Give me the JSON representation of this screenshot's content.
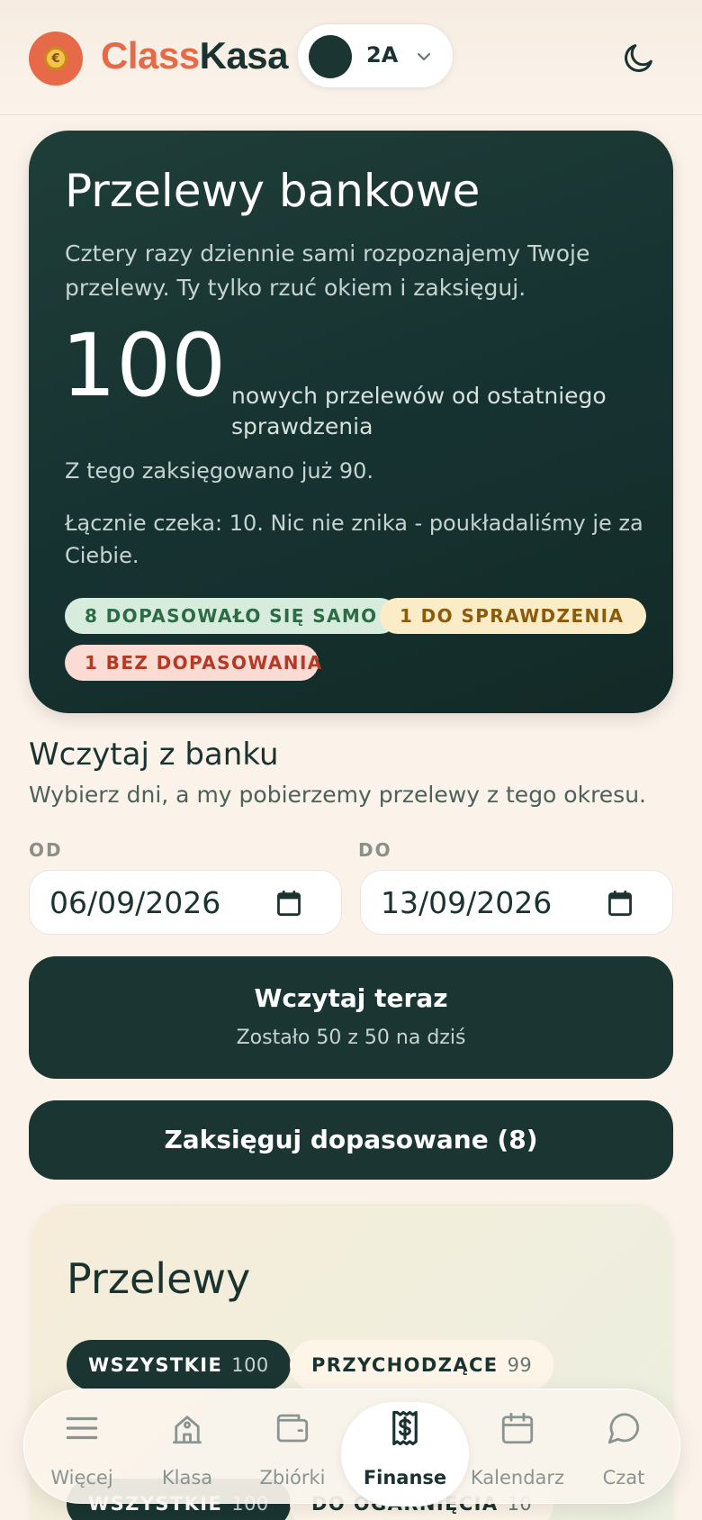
{
  "header": {
    "logo_part1": "Class",
    "logo_part2": "Kasa",
    "class_selector": "2A"
  },
  "hero": {
    "title": "Przelewy bankowe",
    "description": "Cztery razy dziennie sami rozpoznajemy Twoje przelewy. Ty tylko rzuć okiem i zaksięguj.",
    "count": "100",
    "count_label": "nowych przelewów od ostatniego sprawdzenia",
    "booked_text": "Z tego zaksięgowano już 90.",
    "waiting_text": "Łącznie czeka: 10. Nic nie znika - poukładaliśmy je za Ciebie.",
    "chips": {
      "matched": "8 DOPASOWAŁO SIĘ SAMO",
      "review": "1 DO SPRAWDZENIA",
      "unmatched": "1 BEZ DOPASOWANIA"
    }
  },
  "import": {
    "title": "Wczytaj z banku",
    "subtitle": "Wybierz dni, a my pobierzemy przelewy z tego okresu.",
    "from_label": "OD",
    "to_label": "DO",
    "from_value": "06/09/2026",
    "to_value": "13/09/2026",
    "load_button": "Wczytaj teraz",
    "load_quota": "Zostało 50 z 50 na dziś",
    "book_button": "Zaksięguj dopasowane (8)"
  },
  "transfers": {
    "title": "Przelewy",
    "tabs": [
      {
        "label": "WSZYSTKIE",
        "count": "100"
      },
      {
        "label": "PRZYCHODZĄCE",
        "count": "99"
      }
    ],
    "tabs2": [
      {
        "label": "WSZYSTKIE",
        "count": "100"
      },
      {
        "label": "DO OGARNIĘCIA",
        "count": "10"
      }
    ]
  },
  "nav": {
    "items": [
      {
        "label": "Więcej",
        "icon": "menu-icon"
      },
      {
        "label": "Klasa",
        "icon": "school-icon"
      },
      {
        "label": "Zbiórki",
        "icon": "wallet-icon"
      },
      {
        "label": "Finanse",
        "icon": "receipt-dollar-icon"
      },
      {
        "label": "Kalendarz",
        "icon": "calendar-icon"
      },
      {
        "label": "Czat",
        "icon": "chat-icon"
      }
    ],
    "active": "Finanse"
  },
  "colors": {
    "brand": "#e66a47",
    "dark": "#1a3532",
    "background": "#fbf3ea"
  }
}
